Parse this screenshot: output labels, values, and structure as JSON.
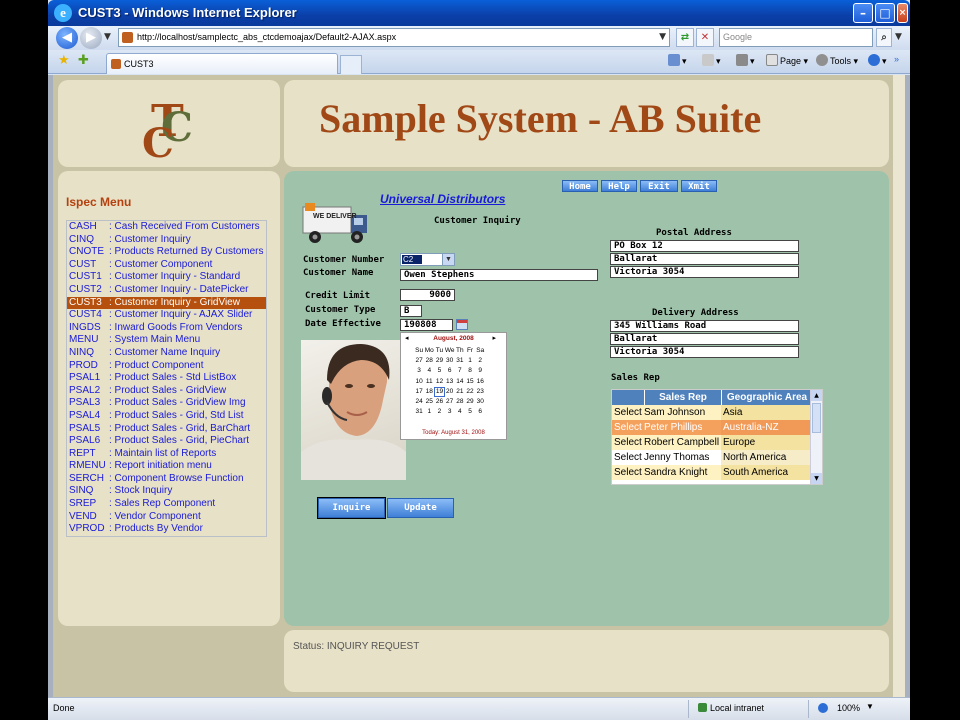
{
  "window": {
    "title": "CUST3 - Windows Internet Explorer"
  },
  "addressbar": {
    "url": "http://localhost/samplectc_abs_ctcdemoajax/Default2-AJAX.aspx",
    "search_placeholder": "Google"
  },
  "tabs": [
    {
      "label": "CUST3"
    }
  ],
  "toolbar": {
    "page_label": "Page",
    "tools_label": "Tools"
  },
  "header": {
    "system_name": "Sample System - AB Suite"
  },
  "menu": {
    "title": "Ispec Menu",
    "selected_index": 6,
    "items": [
      {
        "code": "CASH",
        "label": ": Cash Received From Customers"
      },
      {
        "code": "CINQ",
        "label": ": Customer Inquiry"
      },
      {
        "code": "CNOTE",
        "label": ": Products Returned By Customers"
      },
      {
        "code": "CUST",
        "label": ": Customer Component"
      },
      {
        "code": "CUST1",
        "label": ": Customer Inquiry - Standard"
      },
      {
        "code": "CUST2",
        "label": ": Customer Inquiry - DatePicker"
      },
      {
        "code": "CUST3",
        "label": ": Customer Inquiry - GridView"
      },
      {
        "code": "CUST4",
        "label": ": Customer Inquiry - AJAX Slider"
      },
      {
        "code": "INGDS",
        "label": ": Inward Goods From Vendors"
      },
      {
        "code": "MENU",
        "label": ": System Main Menu"
      },
      {
        "code": "NINQ",
        "label": ": Customer Name Inquiry"
      },
      {
        "code": "PROD",
        "label": ": Product Component"
      },
      {
        "code": "PSAL1",
        "label": ": Product Sales - Std ListBox"
      },
      {
        "code": "PSAL2",
        "label": ": Product Sales - GridView"
      },
      {
        "code": "PSAL3",
        "label": ": Product Sales - GridView Img"
      },
      {
        "code": "PSAL4",
        "label": ": Product Sales - Grid, Std List"
      },
      {
        "code": "PSAL5",
        "label": ": Product Sales - Grid, BarChart"
      },
      {
        "code": "PSAL6",
        "label": ": Product Sales - Grid, PieChart"
      },
      {
        "code": "REPT",
        "label": ": Maintain list of Reports"
      },
      {
        "code": "RMENU",
        "label": ": Report initiation menu"
      },
      {
        "code": "SERCH",
        "label": ": Component Browse Function"
      },
      {
        "code": "SINQ",
        "label": ": Stock Inquiry"
      },
      {
        "code": "SREP",
        "label": ": Sales Rep Component"
      },
      {
        "code": "VEND",
        "label": ": Vendor Component"
      },
      {
        "code": "VPROD",
        "label": ": Products By Vendor"
      }
    ]
  },
  "nav_buttons": {
    "home": "Home",
    "help": "Help",
    "exit": "Exit",
    "xmit": "Xmit"
  },
  "form": {
    "company": "Universal Distributors",
    "screen_title": "Customer Inquiry",
    "truck_text": "WE DELIVER",
    "customer_number_label": "Customer Number",
    "customer_number_value": "C2",
    "customer_name_label": "Customer Name",
    "customer_name_value": "Owen Stephens",
    "credit_limit_label": "Credit Limit",
    "credit_limit_value": "9000",
    "customer_type_label": "Customer Type",
    "customer_type_value": "B",
    "date_effective_label": "Date Effective",
    "date_effective_value": "190808",
    "postal_address_label": "Postal Address",
    "postal_address": [
      "PO Box 12",
      "Ballarat",
      "Victoria 3054"
    ],
    "delivery_address_label": "Delivery Address",
    "delivery_address": [
      "345 Williams Road",
      "Ballarat",
      "Victoria 3054"
    ],
    "sales_rep_label": "Sales Rep",
    "inquire_label": "Inquire",
    "update_label": "Update"
  },
  "calendar": {
    "month_label": "August, 2008",
    "prev": "◂",
    "next": "▸",
    "weekdays": [
      "Su",
      "Mo",
      "Tu",
      "We",
      "Th",
      "Fr",
      "Sa"
    ],
    "weeks": [
      [
        "27",
        "28",
        "29",
        "30",
        "31",
        "1",
        "2"
      ],
      [
        "3",
        "4",
        "5",
        "6",
        "7",
        "8",
        "9"
      ],
      [
        "10",
        "11",
        "12",
        "13",
        "14",
        "15",
        "16"
      ],
      [
        "17",
        "18",
        "19",
        "20",
        "21",
        "22",
        "23"
      ],
      [
        "24",
        "25",
        "26",
        "27",
        "28",
        "29",
        "30"
      ],
      [
        "31",
        "1",
        "2",
        "3",
        "4",
        "5",
        "6"
      ]
    ],
    "selected": "19",
    "today_label": "Today: August 31, 2008"
  },
  "sales_grid": {
    "headers": [
      "",
      "Sales Rep",
      "Geographic Area"
    ],
    "highlight_index": 1,
    "rows": [
      [
        "Select",
        "Sam Johnson",
        "Asia"
      ],
      [
        "Select",
        "Peter Phillips",
        "Australia-NZ"
      ],
      [
        "Select",
        "Robert Campbell",
        "Europe"
      ],
      [
        "Select",
        "Jenny Thomas",
        "North America"
      ],
      [
        "Select",
        "Sandra Knight",
        "South America"
      ]
    ]
  },
  "status_panel": {
    "text": "Status: INQUIRY REQUEST"
  },
  "statusbar": {
    "left": "Done",
    "zone": "Local intranet",
    "zoom": "100%"
  },
  "colors": {
    "accent": "#b5500e",
    "panel": "#e7e1c7",
    "main_bg": "#9fc3aa",
    "link": "#1a1ad8"
  }
}
